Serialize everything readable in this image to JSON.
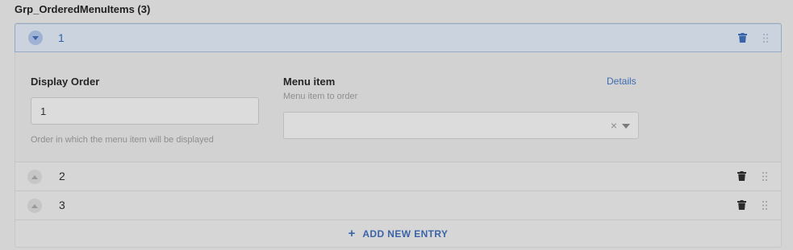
{
  "header": {
    "title": "Grp_OrderedMenuItems (3)"
  },
  "entries": [
    {
      "label": "1",
      "expanded": true
    },
    {
      "label": "2",
      "expanded": false
    },
    {
      "label": "3",
      "expanded": false
    }
  ],
  "form": {
    "display_order": {
      "label": "Display Order",
      "value": "1",
      "hint": "Order in which the menu item will be displayed"
    },
    "menu_item": {
      "label": "Menu item",
      "description": "Menu item to order",
      "details_link": "Details",
      "value": "",
      "clear_symbol": "×"
    }
  },
  "add_entry": {
    "label": "ADD NEW ENTRY",
    "icon": "plus-icon"
  },
  "icons": {
    "toggle": "chevron-icon",
    "delete": "trash-icon",
    "drag": "drag-handle-icon"
  },
  "colors": {
    "accent": "#3a64a8",
    "overlay_bg": "#d4d4d4"
  }
}
